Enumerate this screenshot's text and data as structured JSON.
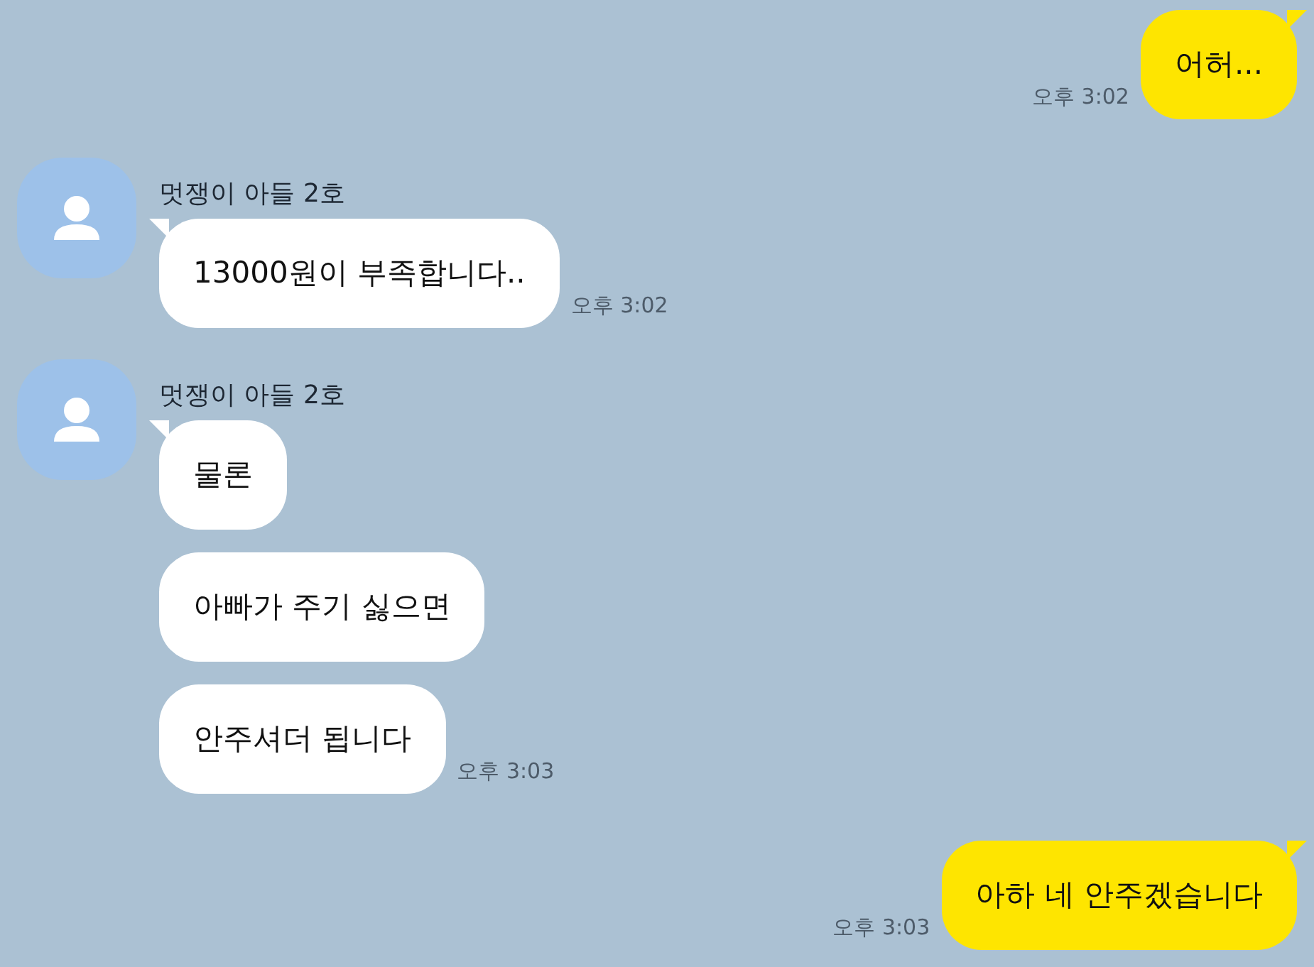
{
  "messages": [
    {
      "kind": "sent",
      "bubbles": [
        "어허..."
      ],
      "time": "오후 3:02"
    },
    {
      "kind": "received",
      "sender": "멋쟁이 아들 2호",
      "bubbles": [
        "13000원이 부족합니다.."
      ],
      "time": "오후 3:02"
    },
    {
      "kind": "received",
      "sender": "멋쟁이 아들 2호",
      "bubbles": [
        "물론",
        "아빠가 주기 싫으면",
        "안주셔더 됩니다"
      ],
      "time": "오후 3:03"
    },
    {
      "kind": "sent",
      "bubbles": [
        "아하 네 안주겠습니다"
      ],
      "time": "오후 3:03"
    }
  ]
}
